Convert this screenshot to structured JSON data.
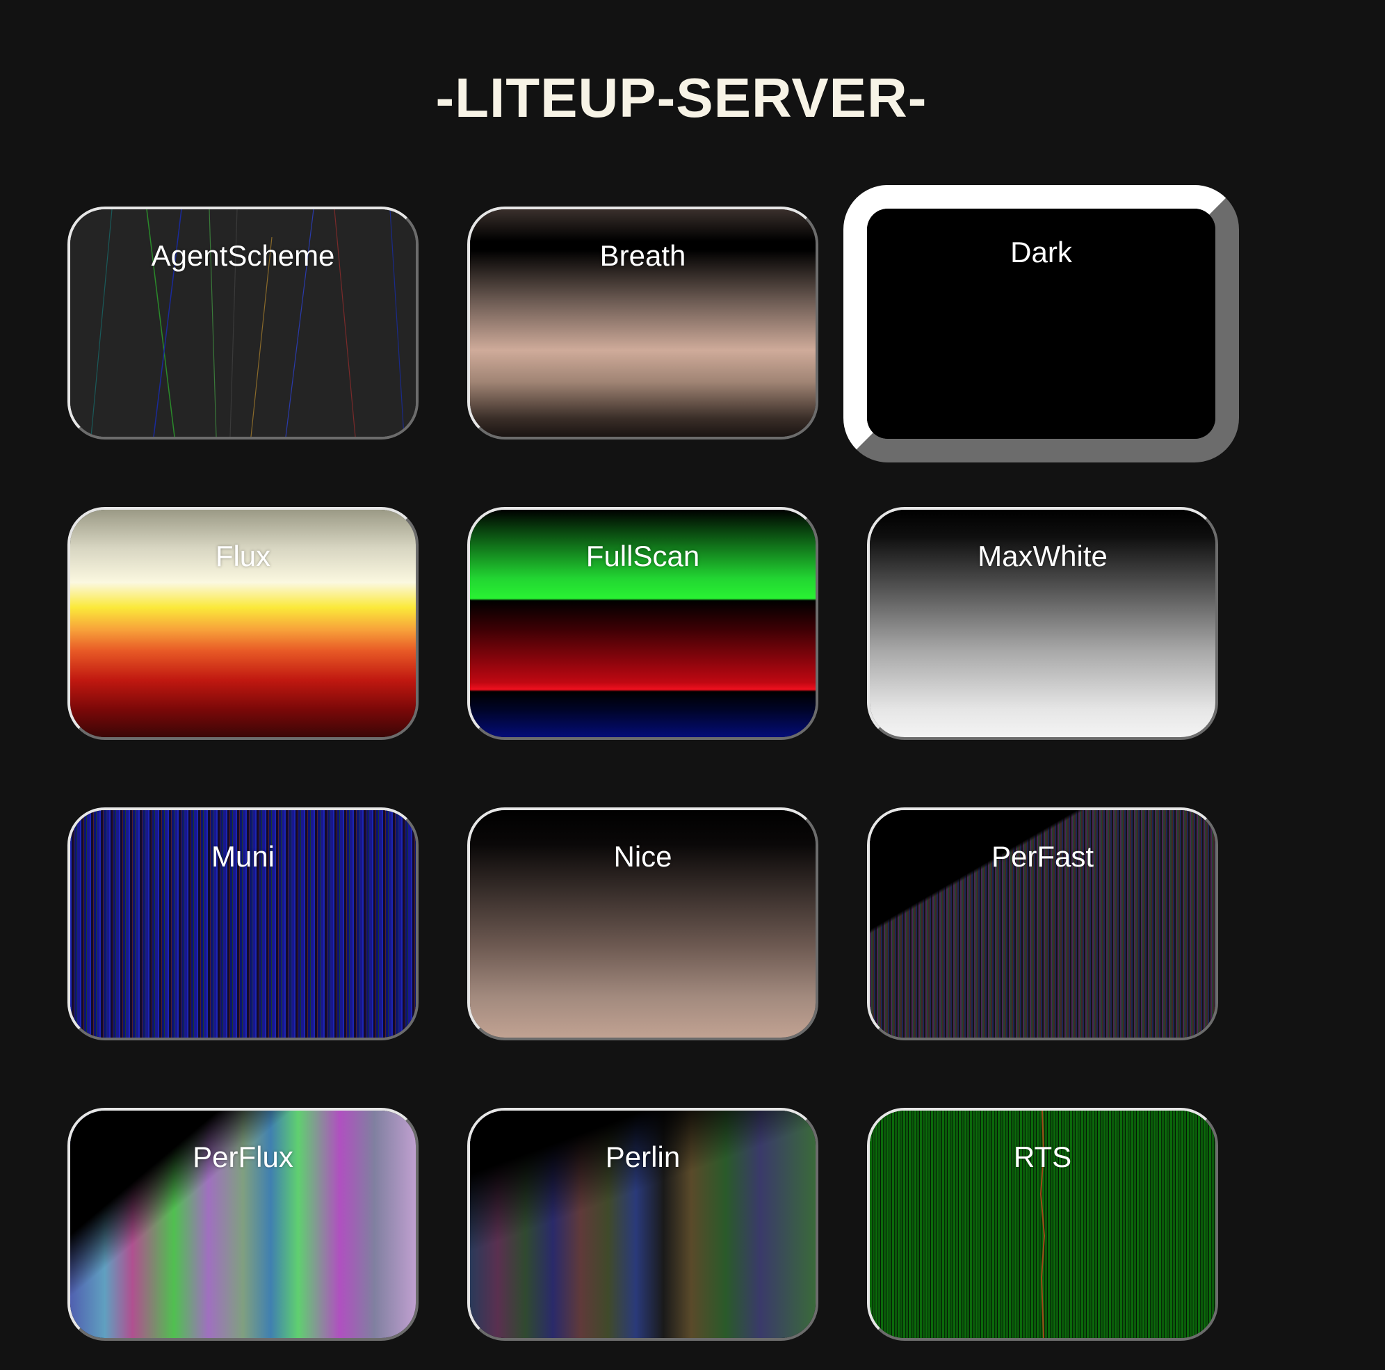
{
  "page": {
    "title": "-LITEUP-SERVER-"
  },
  "selected": "Dark",
  "schemes": [
    {
      "label": "AgentScheme"
    },
    {
      "label": "Breath"
    },
    {
      "label": "Dark"
    },
    {
      "label": "Flux"
    },
    {
      "label": "FullScan"
    },
    {
      "label": "MaxWhite"
    },
    {
      "label": "Muni"
    },
    {
      "label": "Nice"
    },
    {
      "label": "PerFast"
    },
    {
      "label": "PerFlux"
    },
    {
      "label": "Perlin"
    },
    {
      "label": "RTS"
    }
  ]
}
